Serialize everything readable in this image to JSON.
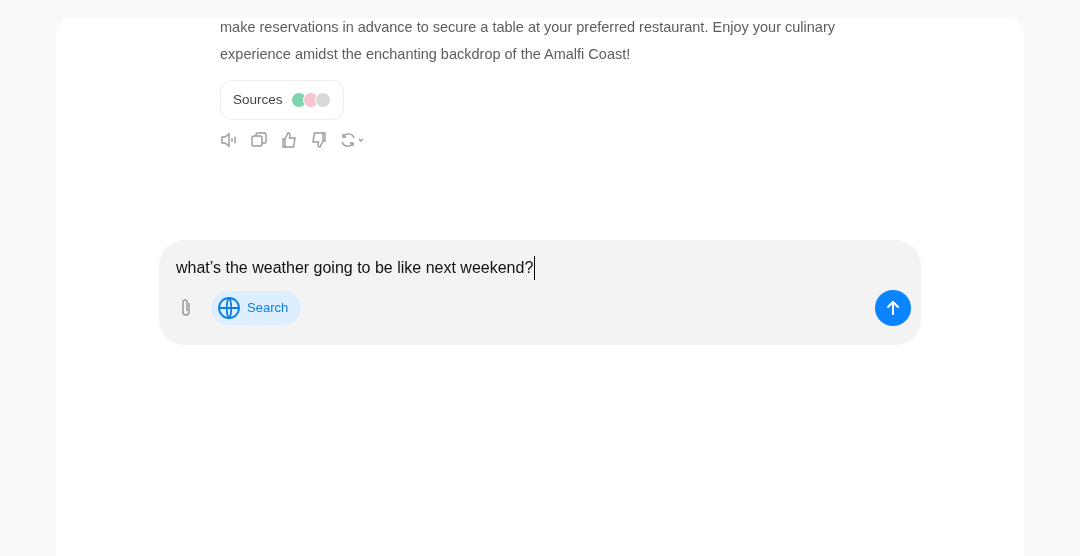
{
  "answer": {
    "text": "make reservations in advance to secure a table at your preferred restaurant. Enjoy your culinary experience amidst the enchanting backdrop of the Amalfi Coast!",
    "sources_label": "Sources",
    "source_icons": [
      {
        "color": "#7fd4b0"
      },
      {
        "color": "#f7c6d0"
      },
      {
        "color": "#d9d9d9"
      }
    ]
  },
  "composer": {
    "value": "what’s the weather going to be like next weekend?",
    "search": {
      "label": "Search",
      "on": true
    }
  }
}
